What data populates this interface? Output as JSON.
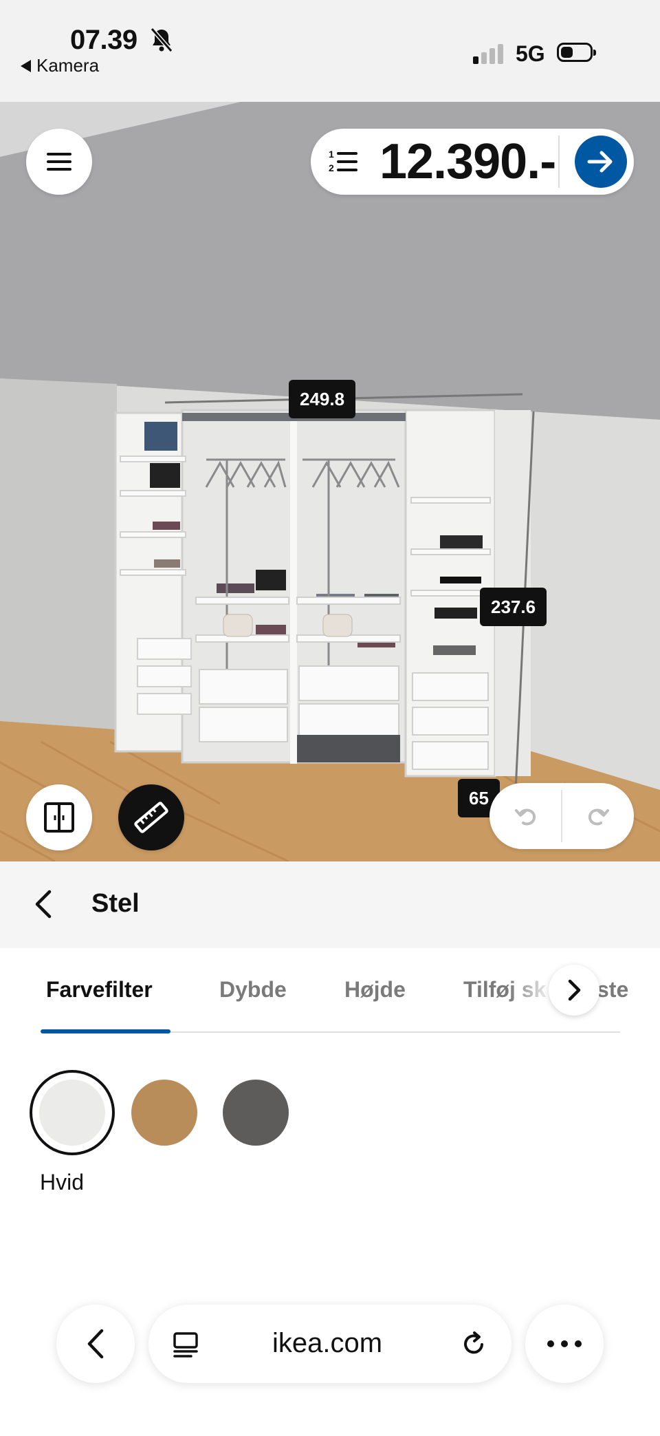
{
  "status_bar": {
    "time": "07.39",
    "back_app": "Kamera",
    "network": "5G",
    "icons": [
      "bell-slash-icon",
      "signal-icon",
      "battery-icon"
    ]
  },
  "planner": {
    "price": "12.390.-",
    "dimensions": {
      "width": "249.8",
      "height": "237.6",
      "depth": "65"
    },
    "icons": [
      "menu-icon",
      "list-icon",
      "arrow-right-icon",
      "doors-icon",
      "ruler-icon",
      "undo-icon",
      "redo-icon"
    ]
  },
  "panel": {
    "title": "Stel",
    "tabs": [
      {
        "label": "Farvefilter",
        "active": true
      },
      {
        "label": "Dybde",
        "active": false
      },
      {
        "label": "Højde",
        "active": false
      },
      {
        "label": "Tilføj sk",
        "active": false
      }
    ],
    "tab_fragment": "ste",
    "swatches": [
      {
        "name": "white",
        "color": "#ebebe9",
        "selected": true
      },
      {
        "name": "oak",
        "color": "#b88d5a",
        "selected": false
      },
      {
        "name": "dark-grey",
        "color": "#5e5b5b",
        "selected": false
      }
    ],
    "selected_swatch_label": "Hvid"
  },
  "browser": {
    "url": "ikea.com"
  },
  "colors": {
    "accent": "#0058a3",
    "label_bg": "#111111"
  }
}
